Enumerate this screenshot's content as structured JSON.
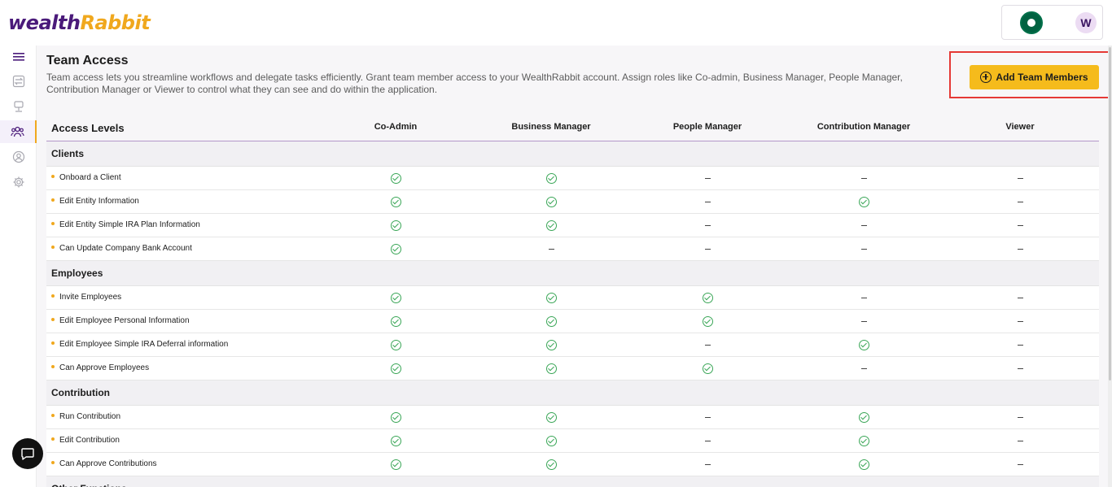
{
  "header": {
    "logo_text_a": "wealth",
    "logo_text_b": "Rabbit",
    "avatar_initial": "W"
  },
  "sidebar": {
    "items": [
      {
        "icon": "hamburger-icon"
      },
      {
        "icon": "transfer-icon"
      },
      {
        "icon": "podium-icon"
      },
      {
        "icon": "team-icon",
        "active": true
      },
      {
        "icon": "user-icon"
      },
      {
        "icon": "gear-icon"
      }
    ]
  },
  "page": {
    "title": "Team Access",
    "description": "Team access lets you streamline workflows and delegate tasks efficiently. Grant team member access to your WealthRabbit account. Assign roles like Co-admin, Business Manager, People Manager, Contribution Manager or Viewer to control what they can see and do within the application.",
    "add_button_label": "Add Team Members"
  },
  "table": {
    "first_header": "Access Levels",
    "roles": [
      "Co-Admin",
      "Business Manager",
      "People Manager",
      "Contribution Manager",
      "Viewer"
    ],
    "sections": [
      {
        "name": "Clients",
        "rows": [
          {
            "label": "Onboard a Client",
            "access": [
              true,
              true,
              false,
              false,
              false
            ]
          },
          {
            "label": "Edit Entity Information",
            "access": [
              true,
              true,
              false,
              true,
              false
            ]
          },
          {
            "label": "Edit Entity Simple IRA Plan Information",
            "access": [
              true,
              true,
              false,
              false,
              false
            ]
          },
          {
            "label": "Can Update Company Bank Account",
            "access": [
              true,
              false,
              false,
              false,
              false
            ]
          }
        ]
      },
      {
        "name": "Employees",
        "rows": [
          {
            "label": "Invite Employees",
            "access": [
              true,
              true,
              true,
              false,
              false
            ]
          },
          {
            "label": "Edit Employee Personal Information",
            "access": [
              true,
              true,
              true,
              false,
              false
            ]
          },
          {
            "label": "Edit Employee Simple IRA Deferral information",
            "access": [
              true,
              true,
              false,
              true,
              false
            ]
          },
          {
            "label": "Can Approve Employees",
            "access": [
              true,
              true,
              true,
              false,
              false
            ]
          }
        ]
      },
      {
        "name": "Contribution",
        "rows": [
          {
            "label": "Run Contribution",
            "access": [
              true,
              true,
              false,
              true,
              false
            ]
          },
          {
            "label": "Edit Contribution",
            "access": [
              true,
              true,
              false,
              true,
              false
            ]
          },
          {
            "label": "Can Approve Contributions",
            "access": [
              true,
              true,
              false,
              true,
              false
            ]
          }
        ]
      },
      {
        "name": "Other Functions",
        "rows": []
      }
    ]
  },
  "colors": {
    "brand_purple": "#4a1a7a",
    "accent_yellow": "#f5bb1c",
    "check_green": "#3aa657",
    "highlight_red": "#e53935"
  }
}
